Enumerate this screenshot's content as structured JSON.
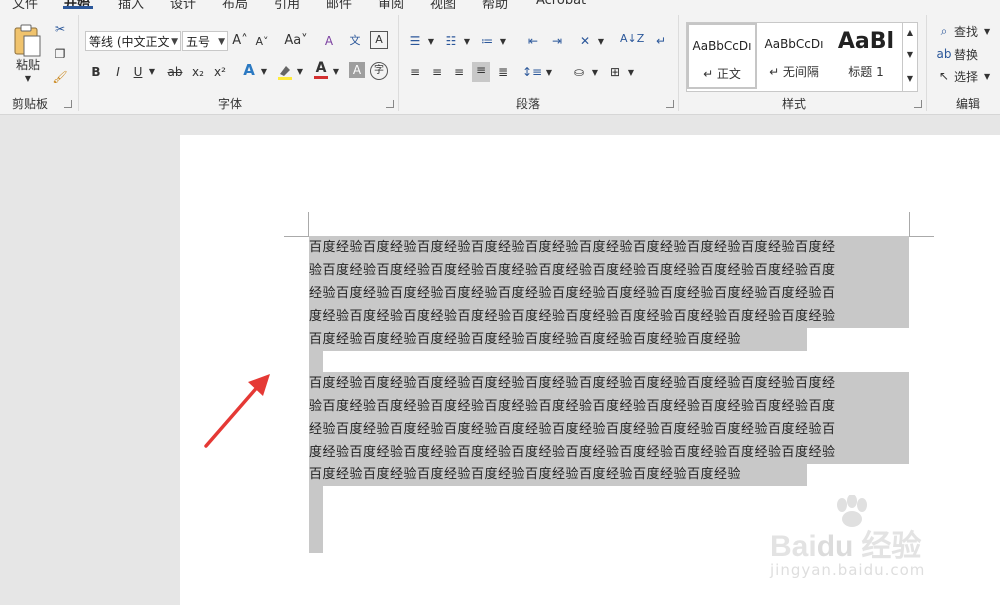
{
  "menu": {
    "tabs": [
      "文件",
      "开始",
      "插入",
      "设计",
      "布局",
      "引用",
      "邮件",
      "审阅",
      "视图",
      "帮助",
      "Acrobat"
    ],
    "active_tab": "开始"
  },
  "ribbon": {
    "clipboard": {
      "paste_label": "粘贴",
      "group_label": "剪贴板"
    },
    "font": {
      "font_name": "等线 (中文正文",
      "font_size": "五号",
      "group_label": "字体",
      "buttons": {
        "bold": "B",
        "italic": "I",
        "underline": "U",
        "strike": "ab",
        "subscript": "x₂",
        "superscript": "x²",
        "grow": "A",
        "shrink": "A",
        "case": "Aa",
        "clear": "A",
        "phonetic": "文",
        "border_char": "A",
        "shade": "A",
        "circle": "字"
      }
    },
    "paragraph": {
      "group_label": "段落"
    },
    "styles": {
      "group_label": "样式",
      "items": [
        {
          "sample": "AaBbCcDı",
          "name": "↵ 正文"
        },
        {
          "sample": "AaBbCcDı",
          "name": "↵ 无间隔"
        },
        {
          "sample": "AaBl",
          "name": "标题 1"
        }
      ]
    },
    "editing": {
      "group_label": "编辑",
      "find": "查找",
      "replace": "替换",
      "select": "选择"
    }
  },
  "document": {
    "paragraph1": [
      "百度经验百度经验百度经验百度经验百度经验百度经验百度经验百度经验百度经验百度经",
      "验百度经验百度经验百度经验百度经验百度经验百度经验百度经验百度经验百度经验百度",
      "经验百度经验百度经验百度经验百度经验百度经验百度经验百度经验百度经验百度经验百",
      "度经验百度经验百度经验百度经验百度经验百度经验百度经验百度经验百度经验百度经验",
      "百度经验百度经验百度经验百度经验百度经验百度经验百度经验百度经验"
    ],
    "paragraph2": [
      "百度经验百度经验百度经验百度经验百度经验百度经验百度经验百度经验百度经验百度经",
      "验百度经验百度经验百度经验百度经验百度经验百度经验百度经验百度经验百度经验百度",
      "经验百度经验百度经验百度经验百度经验百度经验百度经验百度经验百度经验百度经验百",
      "度经验百度经验百度经验百度经验百度经验百度经验百度经验百度经验百度经验百度经验",
      "百度经验百度经验百度经验百度经验百度经验百度经验百度经验百度经验"
    ]
  },
  "watermark": {
    "brand": "Bai",
    "brand2": "du",
    "cn": "经验",
    "url": "jingyan.baidu.com"
  },
  "colors": {
    "accent": "#2b579a",
    "selection": "#c8c8c8",
    "arrow": "#e53935",
    "highlight": "#ffeb3b",
    "font_color": "#d32f2f"
  }
}
